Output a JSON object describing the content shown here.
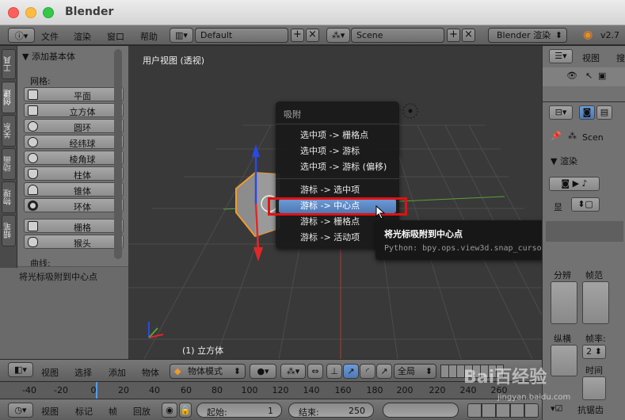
{
  "window": {
    "title": "Blender"
  },
  "header": {
    "menus": [
      "文件",
      "渲染",
      "窗口",
      "帮助"
    ],
    "layout": "Default",
    "scene": "Scene",
    "engine": "Blender 渲染",
    "version": "v2.7"
  },
  "left_tabs": [
    "工具",
    "创建",
    "关系",
    "动画",
    "物理",
    "蜡笔"
  ],
  "tool_shelf": {
    "panel_title": "▼ 添加基本体",
    "mesh_label": "网格:",
    "mesh_items": [
      "平面",
      "立方体",
      "圆环",
      "经纬球",
      "棱角球",
      "柱体",
      "锥体",
      "环体"
    ],
    "other_items": [
      "栅格",
      "猴头"
    ],
    "curve_label": "曲线:",
    "operator_panel": "▼ 将光标吸附到中心点"
  },
  "viewport": {
    "view_label": "用户视图 (透视)",
    "object_label": "(1) 立方体"
  },
  "snap_menu": {
    "title": "吸附",
    "items": [
      "选中项 -> 栅格点",
      "选中项 -> 游标",
      "选中项 -> 游标 (偏移)",
      "游标 -> 选中项",
      "游标 -> 中心点",
      "游标 -> 栅格点",
      "游标 -> 活动项"
    ],
    "highlighted_index": 4
  },
  "tooltip": {
    "title": "将光标吸附到中心点",
    "python": "Python: bpy.ops.view3d.snap_cursor_to_center()"
  },
  "properties": {
    "view_label": "视图",
    "search_label": "搜",
    "scene_field": "Scen",
    "render_panel": "▼ 渲染",
    "display_label": "显",
    "res_label": "分辨",
    "frame_label": "帧范",
    "aspect_label": "纵横",
    "fps_label": "帧率:",
    "fps_value": "2",
    "time_label": "时间",
    "antialias_label": "抗锯齿"
  },
  "view_header": {
    "menus": [
      "视图",
      "选择",
      "添加",
      "物体"
    ],
    "mode": "物体模式",
    "orientation": "全局"
  },
  "timeline": {
    "ticks": [
      "-40",
      "-20",
      "0",
      "20",
      "40",
      "60",
      "80",
      "100",
      "120",
      "140",
      "160",
      "180",
      "200",
      "220",
      "240",
      "260"
    ],
    "current_frame": 1
  },
  "timeline_header": {
    "menus": [
      "视图",
      "标记",
      "帧",
      "回放"
    ],
    "start_label": "起始:",
    "start_value": "1",
    "end_label": "结束:",
    "end_value": "250"
  },
  "watermark": {
    "brand": "Bai百经验",
    "url": "jingyan.baidu.com"
  }
}
